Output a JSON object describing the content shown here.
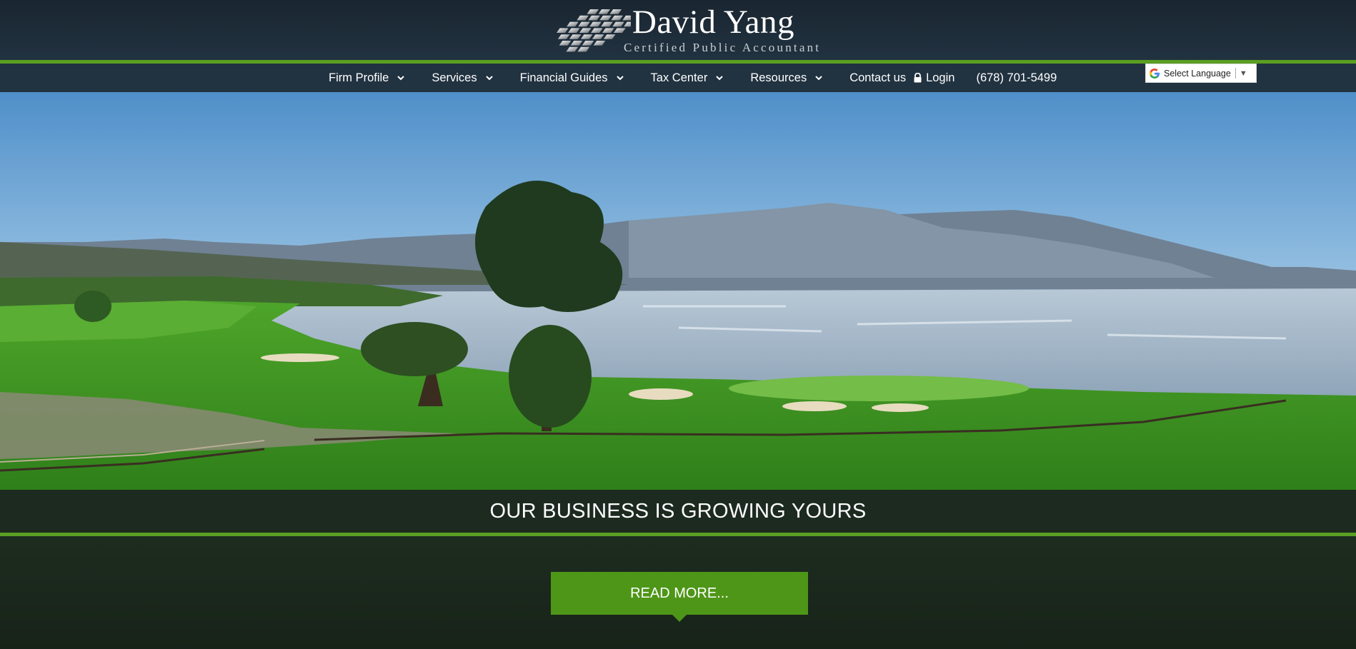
{
  "brand": {
    "name": "David Yang",
    "tagline": "Certified Public Accountant"
  },
  "nav": {
    "items": [
      {
        "label": "Firm Profile",
        "has_dropdown": true
      },
      {
        "label": "Services",
        "has_dropdown": true
      },
      {
        "label": "Financial Guides",
        "has_dropdown": true
      },
      {
        "label": "Tax Center",
        "has_dropdown": true
      },
      {
        "label": "Resources",
        "has_dropdown": true
      },
      {
        "label": "Contact us",
        "has_dropdown": false
      }
    ],
    "login_label": "Login",
    "login_icon": "lock-icon",
    "phone": "(678) 701-5499"
  },
  "language": {
    "label": "Select Language",
    "icon": "google-g-icon",
    "arrow": "▼"
  },
  "hero": {
    "image": "golf-course-ocean-coast",
    "banner": "OUR BUSINESS IS GROWING YOURS"
  },
  "cta": {
    "label": "READ MORE..."
  },
  "colors": {
    "header_bg": "#213240",
    "accent_green": "#5a9e22",
    "button_green": "#4e9618",
    "banner_bg": "#1d2a20"
  }
}
